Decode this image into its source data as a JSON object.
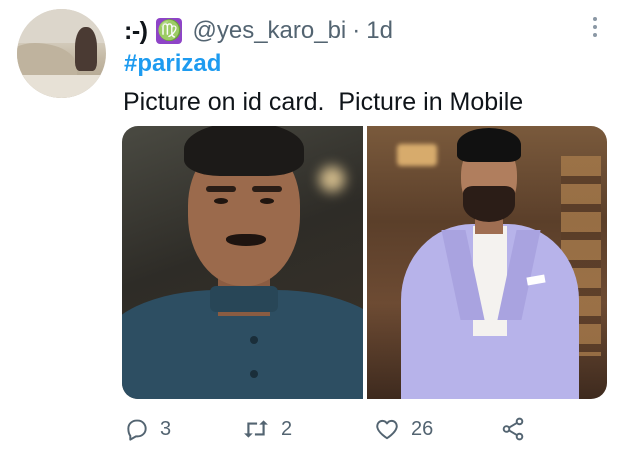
{
  "tweet": {
    "display_name": ":-)",
    "badge": "♍",
    "handle": "@yes_karo_bi",
    "separator": "·",
    "time": "1d",
    "hashtag": "#parizad",
    "text": "Picture on id card.  Picture in Mobile"
  },
  "media": [
    {
      "subject": "Man with mustache in dark blue shirt"
    },
    {
      "subject": "Bearded man in lavender suit"
    }
  ],
  "actions": {
    "reply_count": "3",
    "retweet_count": "2",
    "like_count": "26",
    "share_count": ""
  },
  "colors": {
    "link": "#1d9bf0",
    "muted": "#536471",
    "badge": "#8e44c7"
  },
  "icons": [
    "more-icon",
    "reply-icon",
    "retweet-icon",
    "like-icon",
    "share-icon"
  ]
}
